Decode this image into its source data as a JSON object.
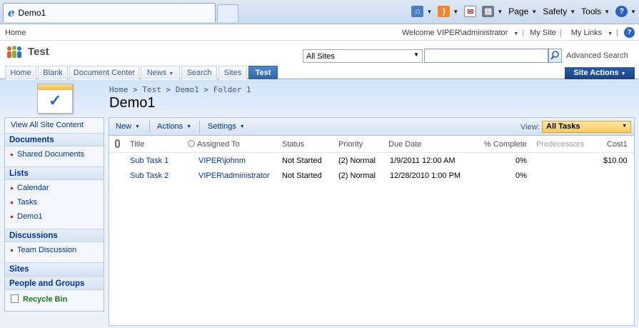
{
  "browser": {
    "tab_title": "Demo1",
    "commands": {
      "page": "Page",
      "safety": "Safety",
      "tools": "Tools"
    }
  },
  "sharepoint": {
    "topline": {
      "home": "Home",
      "welcome": "Welcome VIPER\\administrator",
      "my_site": "My Site",
      "my_links": "My Links"
    },
    "site_title": "Test",
    "search": {
      "scope": "All Sites",
      "query": "",
      "advanced": "Advanced Search"
    },
    "nav_tabs": [
      "Home",
      "Blank",
      "Document Center",
      "News",
      "Search",
      "Sites",
      "Test"
    ],
    "site_actions": "Site Actions",
    "breadcrumb": "Home > Test > Demo1 > Folder 1",
    "page_heading": "Demo1"
  },
  "quicklaunch": {
    "view_all": "View All Site Content",
    "documents": {
      "header": "Documents",
      "items": [
        "Shared Documents"
      ]
    },
    "lists": {
      "header": "Lists",
      "items": [
        "Calendar",
        "Tasks",
        "Demo1"
      ]
    },
    "discussions": {
      "header": "Discussions",
      "items": [
        "Team Discussion"
      ]
    },
    "sites": "Sites",
    "people": "People and Groups",
    "recycle_bin": "Recycle Bin"
  },
  "toolbar": {
    "new": "New",
    "actions": "Actions",
    "settings": "Settings",
    "view_label": "View:",
    "view_value": "All Tasks"
  },
  "columns": [
    "Title",
    "Assigned To",
    "Status",
    "Priority",
    "Due Date",
    "% Complete",
    "Predecessors",
    "Cost1"
  ],
  "rows": [
    {
      "title": "Sub Task 1",
      "assigned": "VIPER\\johnm",
      "status": "Not Started",
      "priority": "(2) Normal",
      "due": "1/9/2011 12:00 AM",
      "complete": "0%",
      "predecessors": "",
      "cost": "$10.00"
    },
    {
      "title": "Sub Task 2",
      "assigned": "VIPER\\administrator",
      "status": "Not Started",
      "priority": "(2) Normal",
      "due": "12/28/2010 1:00 PM",
      "complete": "0%",
      "predecessors": "",
      "cost": ""
    }
  ]
}
